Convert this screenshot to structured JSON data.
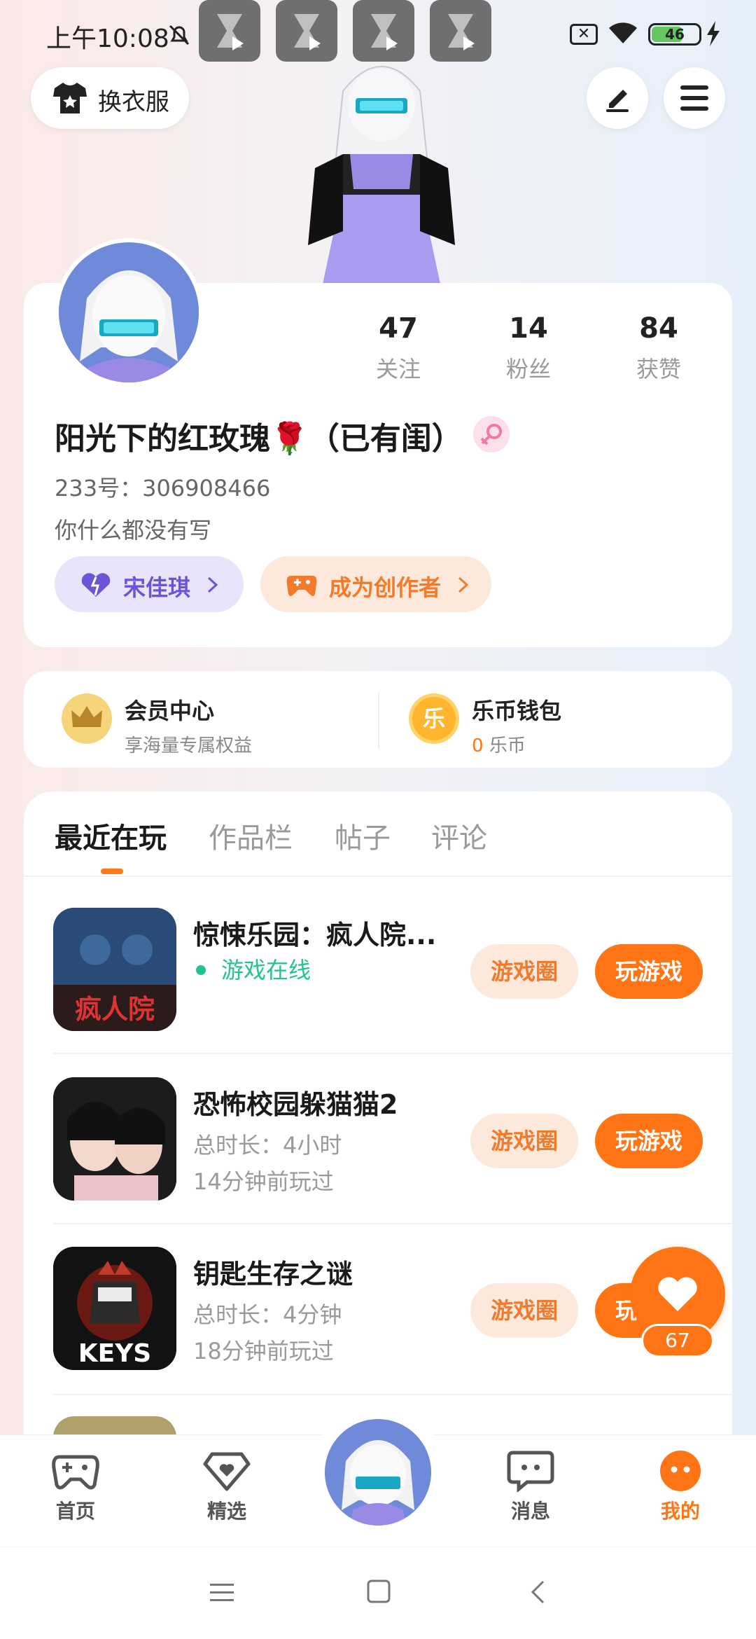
{
  "status_bar": {
    "time": "上午10:08",
    "battery": "46"
  },
  "header": {
    "dress_button": "换衣服"
  },
  "profile": {
    "stats": [
      {
        "value": "47",
        "label": "关注"
      },
      {
        "value": "14",
        "label": "粉丝"
      },
      {
        "value": "84",
        "label": "获赞"
      }
    ],
    "username": "阳光下的红玫瑰🌹（已有闺）",
    "uid": "233号：306908466",
    "bio": "你什么都没有写",
    "partner_chip": "宋佳琪",
    "creator_chip": "成为创作者"
  },
  "vip": {
    "member_title": "会员中心",
    "member_sub": "享海量专属权益",
    "wallet_title": "乐币钱包",
    "wallet_amount": "0",
    "wallet_unit": "乐币",
    "coin_char": "乐"
  },
  "tabs": [
    "最近在玩",
    "作品栏",
    "帖子",
    "评论"
  ],
  "games": [
    {
      "title": "惊悚乐园：疯人院...",
      "line1": "游戏在线",
      "line2": "",
      "icon_text": "疯人院",
      "online": true
    },
    {
      "title": "恐怖校园躲猫猫2",
      "line1": "总时长：4小时",
      "line2": "14分钟前玩过",
      "icon_text": "",
      "online": false
    },
    {
      "title": "钥匙生存之谜",
      "line1": "总时长：4分钟",
      "line2": "18分钟前玩过",
      "icon_text": "KEYS",
      "online": false
    }
  ],
  "buttons": {
    "game_circle": "游戏圈",
    "play": "玩游戏"
  },
  "fab": {
    "count": "67"
  },
  "bottom_nav": [
    {
      "label": "首页",
      "icon": "gamepad-icon"
    },
    {
      "label": "精选",
      "icon": "heart-badge-icon"
    },
    {
      "label": "消息",
      "icon": "chat-icon"
    },
    {
      "label": "我的",
      "icon": "face-icon"
    }
  ],
  "colors": {
    "accent": "#ff7414",
    "online": "#22c38e",
    "partner": "#6a55d8"
  }
}
